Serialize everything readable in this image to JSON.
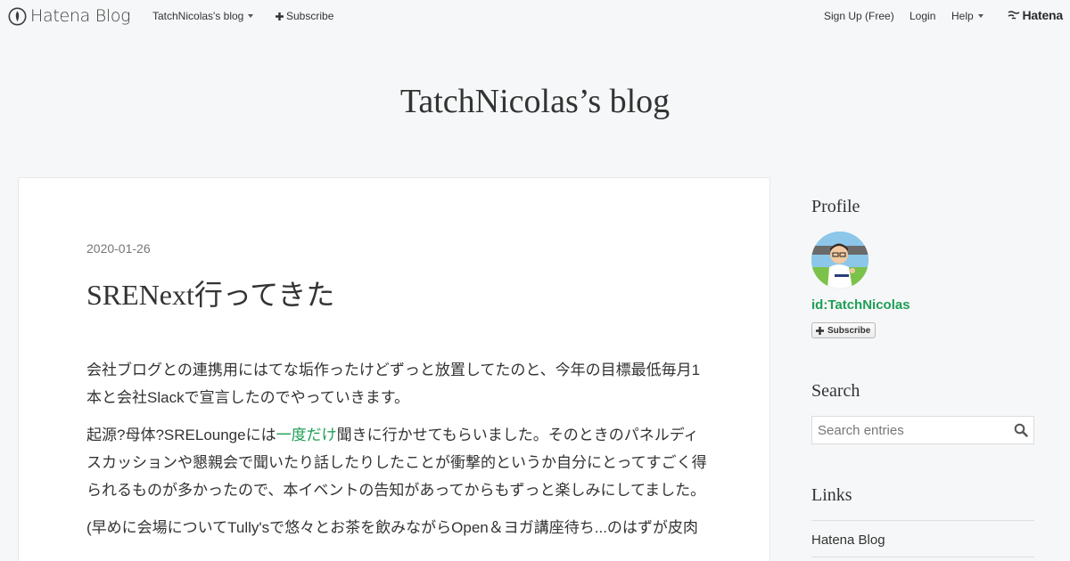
{
  "topbar": {
    "logo_text": "Hatena Blog",
    "blog_menu_label": "TatchNicolas's blog",
    "subscribe_label": "Subscribe",
    "signup_label": "Sign Up (Free)",
    "login_label": "Login",
    "help_label": "Help",
    "brand_label": "Hatena"
  },
  "blog": {
    "title": "TatchNicolas’s blog"
  },
  "entry": {
    "date": "2020-01-26",
    "title": "SRENext行ってきた",
    "paragraph1": "会社ブログとの連携用にはてな垢作ったけどずっと放置してたのと、今年の目標最低毎月1本と会社Slackで宣言したのでやっていきます。",
    "paragraph2_before": "起源?母体?SRELoungeには",
    "paragraph2_link": "一度だけ",
    "paragraph2_after": "聞きに行かせてもらいました。そのときのパネルディスカッションや懇親会で聞いたり話したりしたことが衝撃的というか自分にとってすごく得られるものが多かったので、本イベントの告知があってからもずっと楽しみにしてました。",
    "paragraph3": "(早めに会場についてTully'sで悠々とお茶を飲みながらOpen＆ヨガ講座待ち...のはずが皮肉"
  },
  "sidebar": {
    "profile_heading": "Profile",
    "profile_id": "id:TatchNicolas",
    "subscribe_label": "Subscribe",
    "search_heading": "Search",
    "search_placeholder": "Search entries",
    "links_heading": "Links",
    "links": [
      "Hatena Blog"
    ]
  },
  "colors": {
    "accent_green": "#1e9e56",
    "page_bg": "#f6f7f8"
  }
}
